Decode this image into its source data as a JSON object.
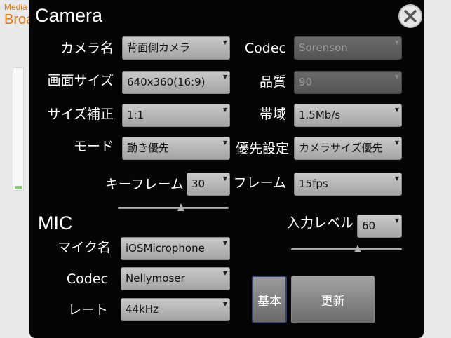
{
  "background": {
    "title_line1": "Media",
    "title_line2": "Broa"
  },
  "camera": {
    "title": "Camera",
    "name_label": "カメラ名",
    "name_value": "背面側カメラ",
    "size_label": "画面サイズ",
    "size_value": "640x360(16:9)",
    "correction_label": "サイズ補正",
    "correction_value": "1:1",
    "mode_label": "モード",
    "mode_value": "動き優先",
    "keyframe_label": "キーフレーム",
    "keyframe_value": "30",
    "keyframe_slider_level": 0.57,
    "codec_label": "Codec",
    "codec_value": "Sorenson",
    "quality_label": "品質",
    "quality_value": "90",
    "bandwidth_label": "帯域",
    "bandwidth_value": "1.5Mb/s",
    "priority_label": "優先設定",
    "priority_value": "カメラサイズ優先",
    "framerate_label": "フレーム",
    "framerate_value": "15fps"
  },
  "mic": {
    "title": "MIC",
    "name_label": "マイク名",
    "name_value": "iOSMicrophone",
    "codec_label": "Codec",
    "codec_value": "Nellymoser",
    "rate_label": "レート",
    "rate_value": "44kHz",
    "input_level_label": "入力レベル",
    "input_level_value": "60",
    "input_level_slider_level": 0.6
  },
  "buttons": {
    "basic": "基本",
    "update": "更新"
  },
  "colors": {
    "dialog_bg": "#050505",
    "accent_orange": "#e07a10",
    "active_border": "#33406b"
  },
  "icons": {
    "close": "close-icon",
    "dropdown": "dropdown-arrow-icon"
  }
}
